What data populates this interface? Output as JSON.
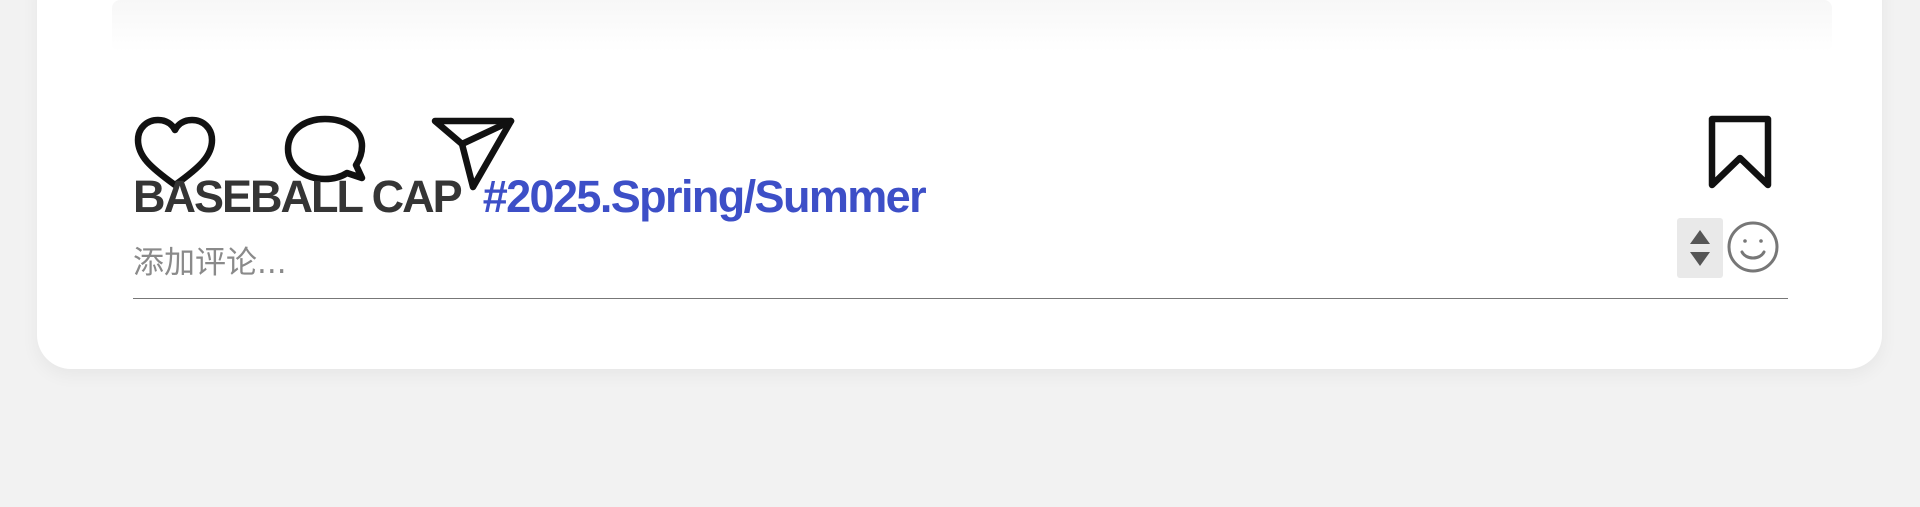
{
  "post": {
    "actions": {
      "like": "heart-icon",
      "comment": "comment-icon",
      "share": "send-icon",
      "save": "bookmark-icon"
    },
    "caption": {
      "product_name": "BASEBALL CAP",
      "hashtag": "#2025.Spring/Summer"
    },
    "comment_box": {
      "placeholder": "添加评论...",
      "value": "",
      "stepper": "stepper-control",
      "emoji": "emoji-smile-icon"
    }
  },
  "colors": {
    "background": "#f2f2f2",
    "card": "#ffffff",
    "icon": "#111111",
    "caption": "#353535",
    "hashtag": "#3d4fc7",
    "placeholder": "#8a8a8a"
  }
}
